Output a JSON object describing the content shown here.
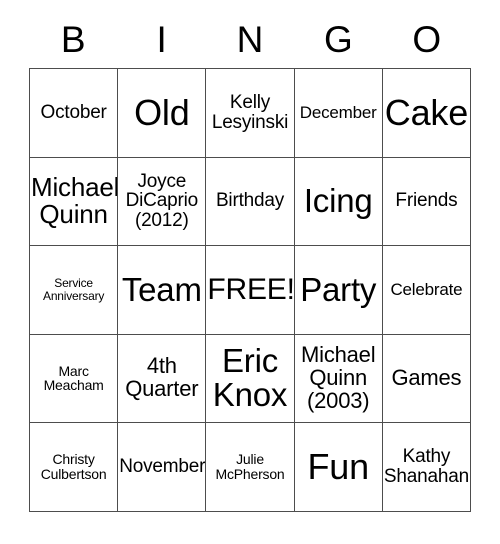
{
  "card": {
    "header_letters": [
      "B",
      "I",
      "N",
      "G",
      "O"
    ],
    "rows": [
      [
        {
          "text": "October",
          "size": "fs-ml"
        },
        {
          "text": "Old",
          "size": "fs-4xl"
        },
        {
          "text": "Kelly\nLesyinski",
          "size": "fs-ml"
        },
        {
          "text": "December",
          "size": "fs-m"
        },
        {
          "text": "Cake",
          "size": "fs-4xl"
        }
      ],
      [
        {
          "text": "Michael\nQuinn",
          "size": "fs-xl"
        },
        {
          "text": "Joyce\nDiCaprio\n(2012)",
          "size": "fs-ml"
        },
        {
          "text": "Birthday",
          "size": "fs-ml"
        },
        {
          "text": "Icing",
          "size": "fs-3xl"
        },
        {
          "text": "Friends",
          "size": "fs-ml"
        }
      ],
      [
        {
          "text": "Service\nAnniversary",
          "size": "fs-xs"
        },
        {
          "text": "Team",
          "size": "fs-3xl"
        },
        {
          "text": "FREE!",
          "size": "fs-xxl"
        },
        {
          "text": "Party",
          "size": "fs-3xl"
        },
        {
          "text": "Celebrate",
          "size": "fs-m"
        }
      ],
      [
        {
          "text": "Marc\nMeacham",
          "size": "fs-s"
        },
        {
          "text": "4th\nQuarter",
          "size": "fs-l"
        },
        {
          "text": "Eric\nKnox",
          "size": "fs-3xl"
        },
        {
          "text": "Michael\nQuinn\n(2003)",
          "size": "fs-l"
        },
        {
          "text": "Games",
          "size": "fs-l"
        }
      ],
      [
        {
          "text": "Christy\nCulbertson",
          "size": "fs-s"
        },
        {
          "text": "November",
          "size": "fs-ml"
        },
        {
          "text": "Julie\nMcPherson",
          "size": "fs-s"
        },
        {
          "text": "Fun",
          "size": "fs-4xl"
        },
        {
          "text": "Kathy\nShanahan",
          "size": "fs-ml"
        }
      ]
    ]
  },
  "colors": {
    "background": "#ffffff",
    "border": "#4d4d4d",
    "text": "#000000"
  }
}
